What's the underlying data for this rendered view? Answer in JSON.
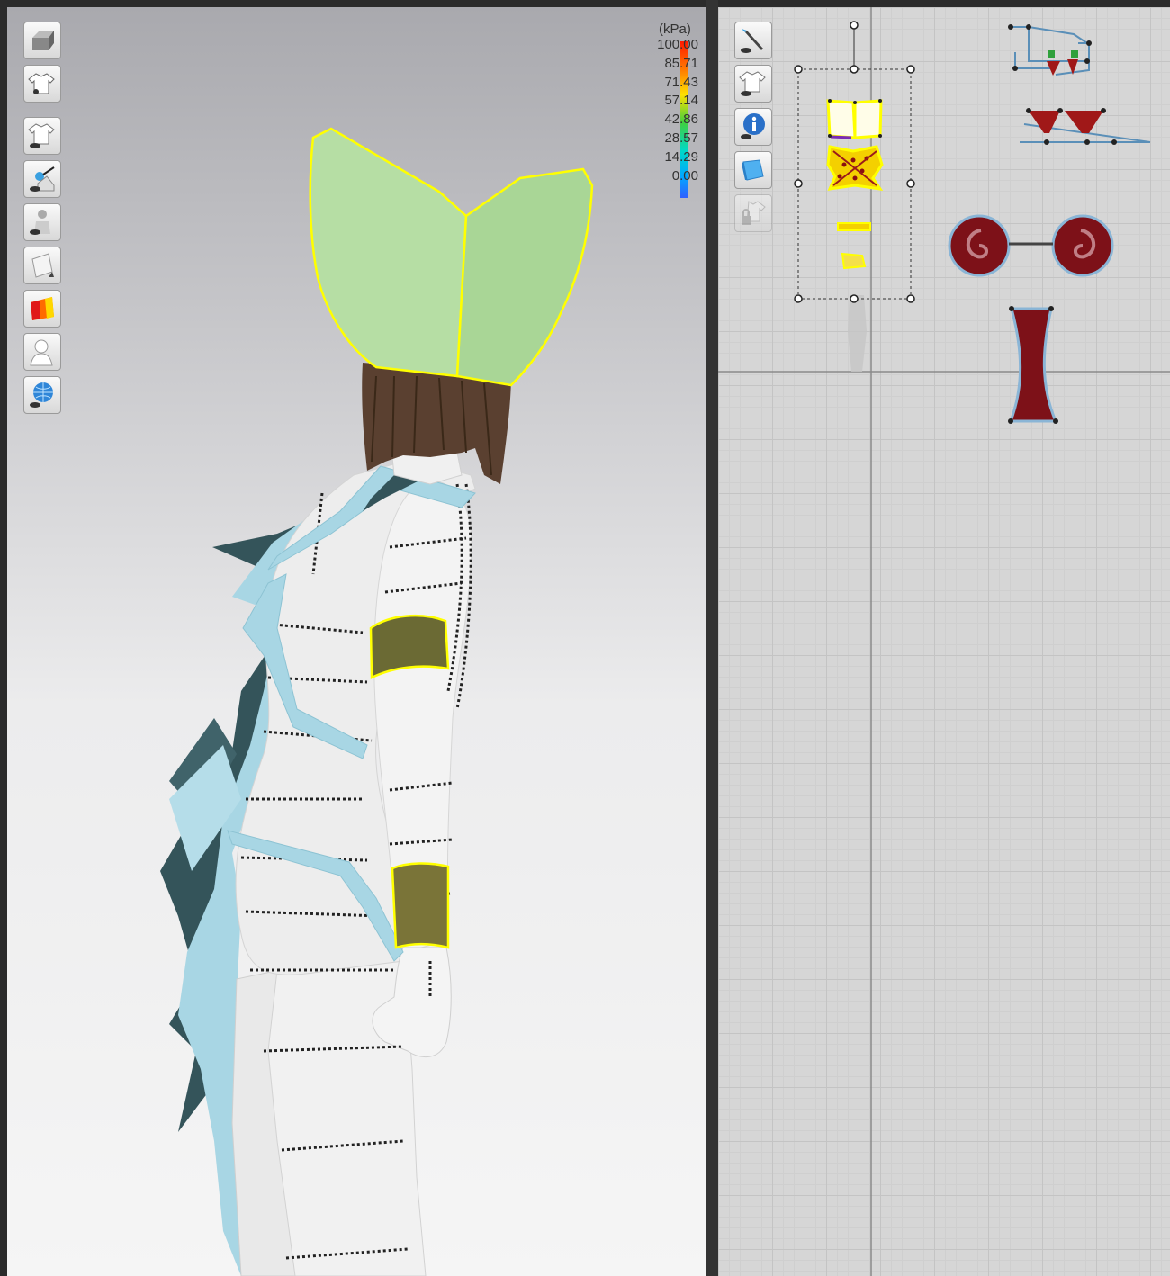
{
  "viewport_3d": {
    "legend": {
      "unit": "(kPa)",
      "ticks": [
        "100.00",
        "85.71",
        "71.43",
        "57.14",
        "42.86",
        "28.57",
        "14.29",
        "0.00"
      ]
    },
    "toolbar_icons": [
      "avatar-box-icon",
      "show-garment-icon",
      "show-garment-eye-icon",
      "show-pins-icon",
      "show-avatar-icon",
      "texture-icon",
      "pressure-map-icon",
      "avatar-silhouette-icon",
      "globe-icon"
    ]
  },
  "viewport_2d": {
    "toolbar_icons": [
      "pen-eye-icon",
      "garment-2d-icon",
      "info-icon",
      "fabric-icon",
      "lock-garment-icon"
    ]
  },
  "colors": {
    "selection": "#ffff00",
    "hat": "#b6dea4",
    "cape_dark": "#34545a",
    "cape_light": "#a8d6e4",
    "band": "#6b6a34",
    "pattern_red": "#7d1118"
  }
}
